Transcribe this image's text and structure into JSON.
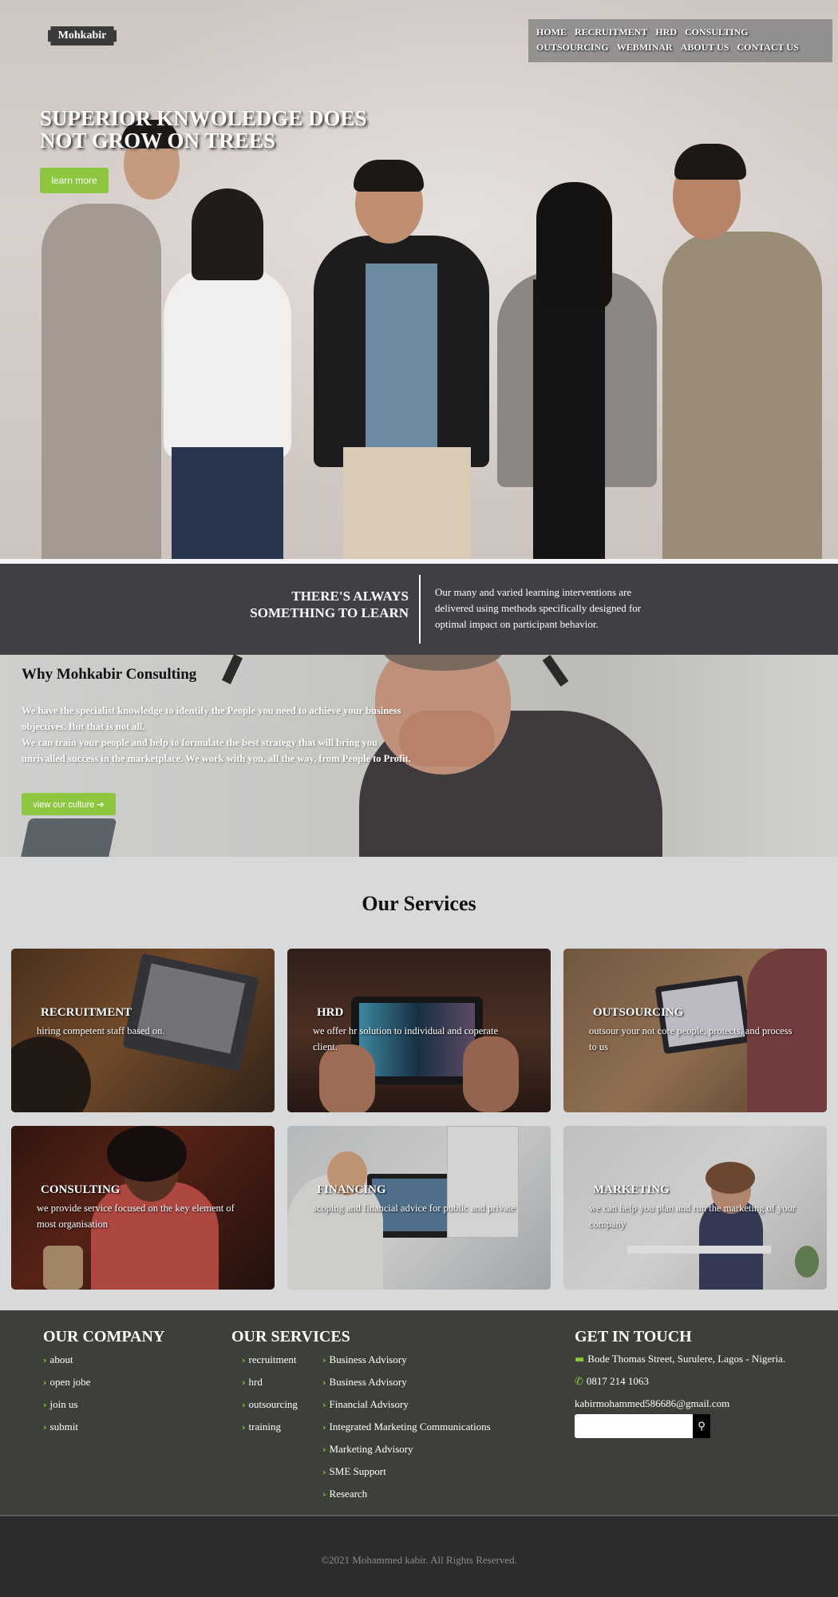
{
  "header": {
    "logo": "Mohkabir",
    "nav": [
      "HOME",
      "RECRUITMENT",
      "HRD",
      "CONSULTING",
      "OUTSOURCING",
      "WEBMINAR",
      "ABOUT US",
      "CONTACT US"
    ]
  },
  "hero": {
    "title": "SUPERIOR KNWOLEDGE DOES NOT GROW ON TREES",
    "button": "learn more"
  },
  "band": {
    "headline_line1": "THERE'S ALWAYS",
    "headline_line2": "SOMETHING TO LEARN",
    "text": "Our many and varied learning interventions are delivered using methods specifically designed for optimal impact on participant behavior."
  },
  "why": {
    "title": "Why Mohkabir Consulting",
    "paragraph1": "We have the specialist knowledge to identify the People you need to achieve your business objectives. But that is not all.",
    "paragraph2": "We can train your people and help to formulate the best strategy that will bring you unrivalled success in the marketplace. We work with you, all the way, from People to Profit.",
    "button": "view our culture"
  },
  "services": {
    "title": "Our Services",
    "cards": [
      {
        "title": "RECRUITMENT",
        "desc": "hiring competent staff based on."
      },
      {
        "title": "HRD",
        "desc": "we offer hr solution to individual and coperate client."
      },
      {
        "title": "OUTSOURCING",
        "desc": "outsour your not core people, protects, and process to us"
      },
      {
        "title": "CONSULTING",
        "desc": "we provide service focused on the key element of most organisation"
      },
      {
        "title": "FINANCING",
        "desc": "scoping and financial advice for public and private"
      },
      {
        "title": "MARKETING",
        "desc": "we can help you plan and run the marketing of your company"
      }
    ]
  },
  "footer": {
    "company_title": "OUR COMPANY",
    "company_links": [
      "about",
      "open jobe",
      "join us",
      "submit"
    ],
    "services_title": "OUR SERVICES",
    "services_links": [
      "recruitment",
      "hrd",
      "outsourcing",
      "training"
    ],
    "services_more": [
      "Business Advisory",
      "Business Advisory",
      "Financial Advisory",
      "Integrated Marketing Communications",
      "Marketing Advisory",
      "SME Support",
      "Research"
    ],
    "contact_title": "GET IN TOUCH",
    "address": "Bode Thomas Street, Surulere, Lagos - Nigeria.",
    "phone": "0817 214 1063",
    "email": "kabirmohammed586686@gmail.com",
    "search_placeholder": "",
    "copyright": "©2021 Mohammed kabir. All Rights Reserved."
  },
  "icons": {
    "chevron": "chevron-right-icon",
    "address": "id-card-icon",
    "phone": "phone-icon",
    "search": "search-icon",
    "arrow": "arrow-right-icon"
  },
  "colors": {
    "accent": "#8dc63f",
    "band": "#403f44",
    "footer": "#3c3f3a",
    "footer_bottom": "#2c2c2e"
  }
}
